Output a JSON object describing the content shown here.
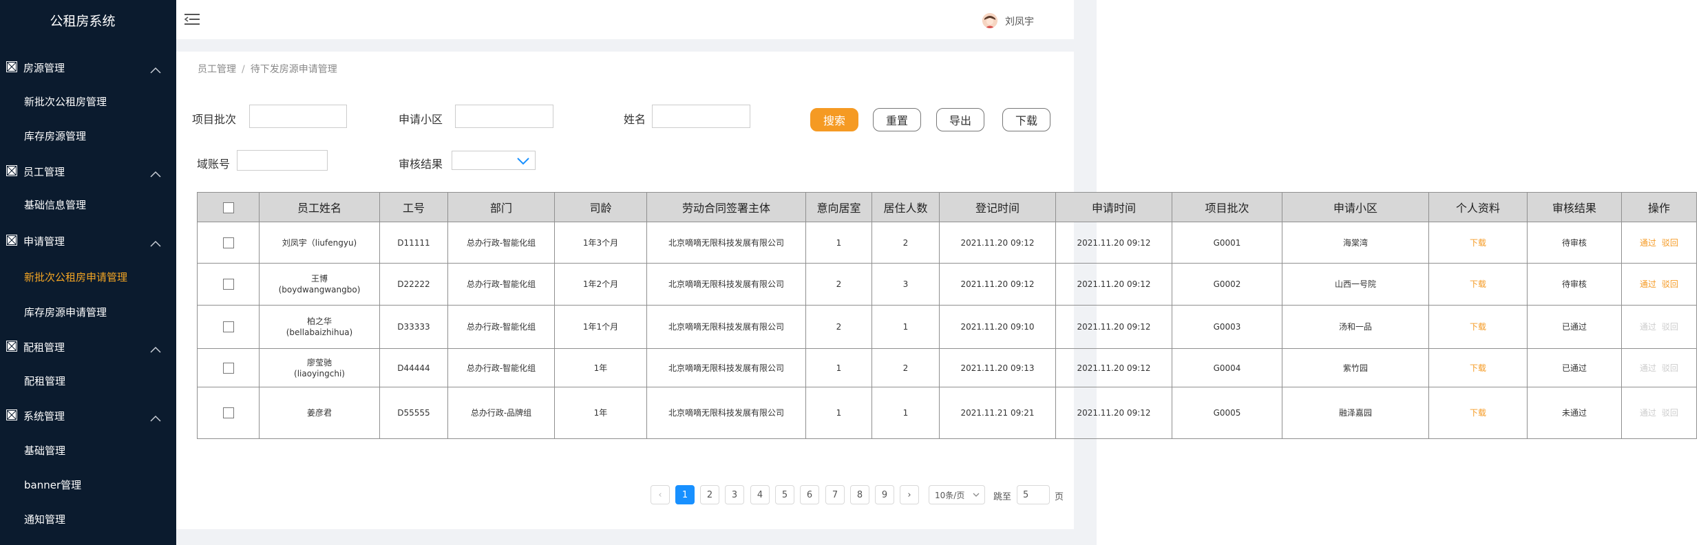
{
  "app": {
    "title": "公租房系统"
  },
  "sidebar": {
    "groups": [
      {
        "label": "房源管理",
        "items": [
          "新批次公租房管理",
          "库存房源管理"
        ]
      },
      {
        "label": "员工管理",
        "items": [
          "基础信息管理"
        ]
      },
      {
        "label": "申请管理",
        "items": [
          "新批次公租房申请管理",
          "库存房源申请管理"
        ]
      },
      {
        "label": "配租管理",
        "items": [
          "配租管理"
        ]
      },
      {
        "label": "系统管理",
        "items": [
          "基础管理",
          "banner管理",
          "通知管理"
        ]
      }
    ],
    "active_item": "新批次公租房申请管理"
  },
  "header": {
    "user_name": "刘凤宇"
  },
  "breadcrumb": {
    "items": [
      "员工管理",
      "待下发房源申请管理"
    ],
    "separator": "/"
  },
  "filters": {
    "batch_label": "项目批次",
    "community_label": "申请小区",
    "name_label": "姓名",
    "domain_label": "域账号",
    "result_label": "审核结果",
    "batch_value": "",
    "community_value": "",
    "name_value": "",
    "domain_value": ""
  },
  "buttons": {
    "search": "搜索",
    "reset": "重置",
    "export": "导出",
    "download": "下载"
  },
  "table": {
    "columns": [
      "员工姓名",
      "工号",
      "部门",
      "司龄",
      "劳动合同签署主体",
      "意向居室",
      "居住人数",
      "登记时间",
      "申请时间",
      "项目批次",
      "申请小区",
      "个人资料",
      "审核结果",
      "操作"
    ],
    "rows": [
      {
        "name": "刘凤宇（liufengyu)",
        "id": "D11111",
        "dept": "总办行政-智能化组",
        "tenure": "1年3个月",
        "employer": "北京嘀嘀无限科技发展有限公司",
        "rooms": "1",
        "residents": "2",
        "reg_time": "2021.11.20  09:12",
        "apply_time": "2021.11.20  09:12",
        "batch": "G0001",
        "community": "海棠湾",
        "profile": "下载",
        "result": "待审核",
        "approve": "通过",
        "reject": "驳回",
        "actions_enabled": true
      },
      {
        "name": "王博\n(boydwangwangbo)",
        "id": "D22222",
        "dept": "总办行政-智能化组",
        "tenure": "1年2个月",
        "employer": "北京嘀嘀无限科技发展有限公司",
        "rooms": "2",
        "residents": "3",
        "reg_time": "2021.11.20  09:12",
        "apply_time": "2021.11.20  09:12",
        "batch": "G0002",
        "community": "山西一号院",
        "profile": "下载",
        "result": "待审核",
        "approve": "通过",
        "reject": "驳回",
        "actions_enabled": true
      },
      {
        "name": "柏之华\n(bellabaizhihua)",
        "id": "D33333",
        "dept": "总办行政-智能化组",
        "tenure": "1年1个月",
        "employer": "北京嘀嘀无限科技发展有限公司",
        "rooms": "2",
        "residents": "1",
        "reg_time": "2021.11.20  09:10",
        "apply_time": "2021.11.20  09:12",
        "batch": "G0003",
        "community": "汤和一品",
        "profile": "下载",
        "result": "已通过",
        "approve": "通过",
        "reject": "驳回",
        "actions_enabled": false
      },
      {
        "name": "廖莹驰\n(liaoyingchi)",
        "id": "D44444",
        "dept": "总办行政-智能化组",
        "tenure": "1年",
        "employer": "北京嘀嘀无限科技发展有限公司",
        "rooms": "1",
        "residents": "2",
        "reg_time": "2021.11.20  09:13",
        "apply_time": "2021.11.20  09:12",
        "batch": "G0004",
        "community": "紫竹园",
        "profile": "下载",
        "result": "已通过",
        "approve": "通过",
        "reject": "驳回",
        "actions_enabled": false
      },
      {
        "name": "姜彦君",
        "id": "D55555",
        "dept": "总办行政-品牌组",
        "tenure": "1年",
        "employer": "北京嘀嘀无限科技发展有限公司",
        "rooms": "1",
        "residents": "1",
        "reg_time": "2021.11.21  09:21",
        "apply_time": "2021.11.20  09:12",
        "batch": "G0005",
        "community": "融泽嘉园",
        "profile": "下载",
        "result": "未通过",
        "approve": "通过",
        "reject": "驳回",
        "actions_enabled": false
      }
    ]
  },
  "pagination": {
    "pages": [
      "1",
      "2",
      "3",
      "4",
      "5",
      "6",
      "7",
      "8",
      "9"
    ],
    "current": "1",
    "prev": "‹",
    "next": "›",
    "page_size": "10条/页",
    "jump_label": "跳至",
    "jump_value": "5",
    "page_unit": "页"
  },
  "colors": {
    "sidebar_bg": "#0b1b2e",
    "accent": "#f59a23",
    "active_page": "#1890ff"
  }
}
